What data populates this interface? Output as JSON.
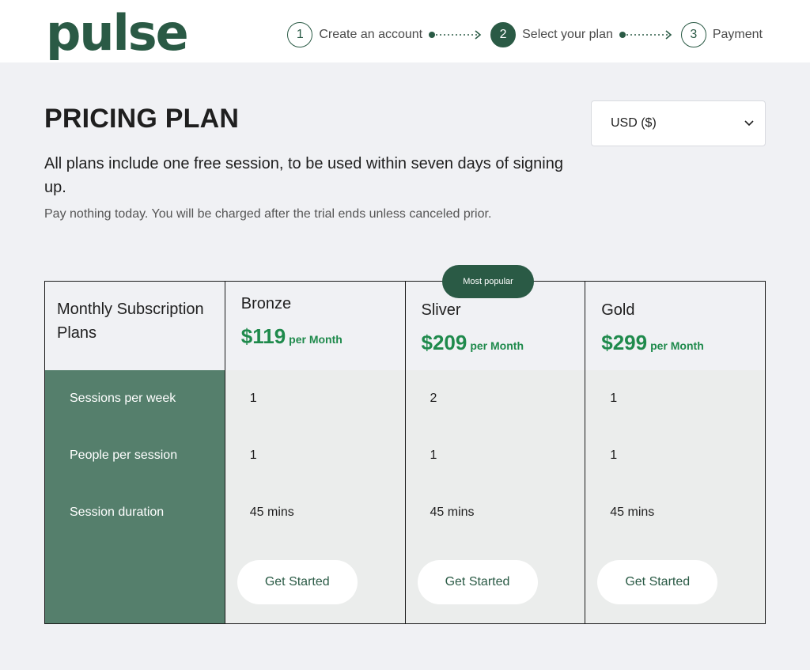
{
  "brand": {
    "logo": "pulse",
    "accent": "#2a5a45",
    "price_color": "#1f8a4c"
  },
  "steps": [
    {
      "num": "1",
      "label": "Create an account",
      "active": false
    },
    {
      "num": "2",
      "label": "Select your plan",
      "active": true
    },
    {
      "num": "3",
      "label": "Payment",
      "active": false
    }
  ],
  "page": {
    "title": "PRICING PLAN",
    "lead": "All plans include one free session, to be used within seven days of signing up.",
    "sub": "Pay nothing today. You will be charged after the trial ends unless canceled prior."
  },
  "currency": {
    "selected": "USD ($)"
  },
  "table": {
    "header_label": "Monthly Subscription Plans",
    "badge": "Most popular",
    "rows": [
      "Sessions per week",
      "People per session",
      "Session duration"
    ],
    "plans": [
      {
        "name": "Bronze",
        "price": "$119",
        "unit": "per Month",
        "values": [
          "1",
          "1",
          "45 mins"
        ],
        "cta": "Get Started"
      },
      {
        "name": "Sliver",
        "price": "$209",
        "unit": "per Month",
        "values": [
          "2",
          "1",
          "45 mins"
        ],
        "cta": "Get Started"
      },
      {
        "name": "Gold",
        "price": "$299",
        "unit": "per Month",
        "values": [
          "1",
          "1",
          "45 mins"
        ],
        "cta": "Get Started"
      }
    ]
  }
}
